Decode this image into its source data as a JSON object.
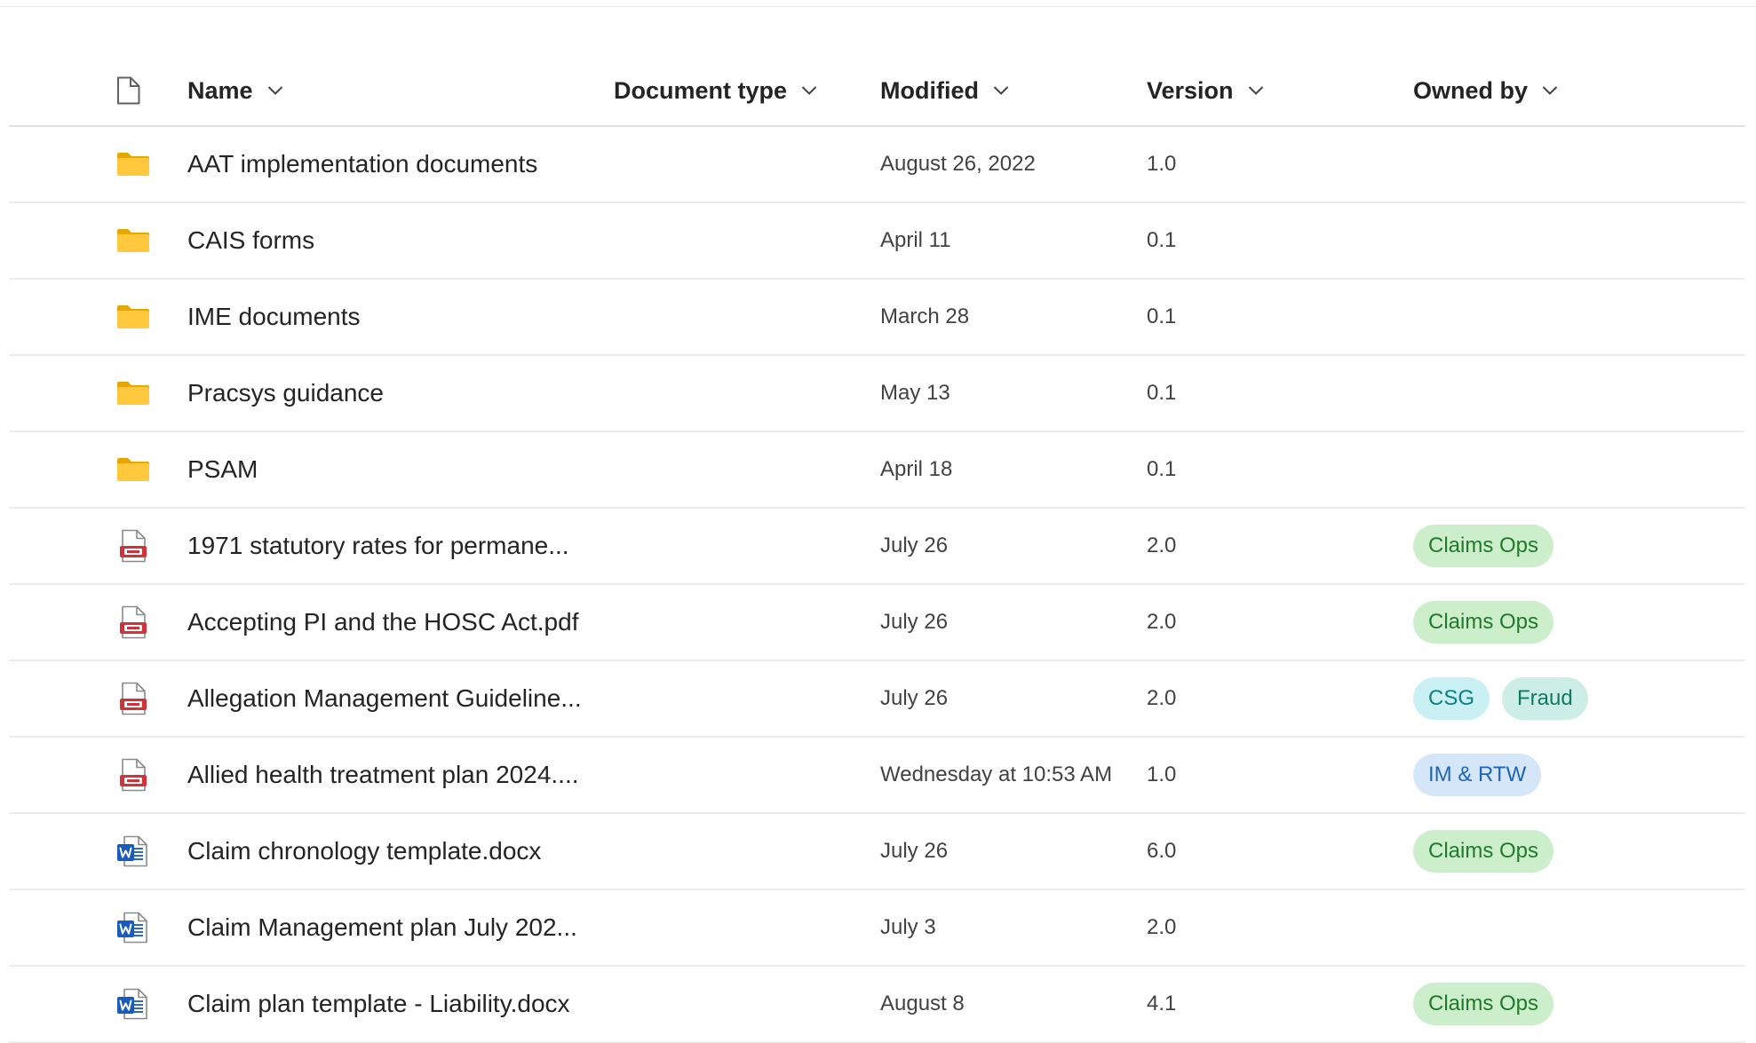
{
  "columns": {
    "type_icon": "document-icon",
    "name": "Name",
    "doc_type": "Document type",
    "modified": "Modified",
    "version": "Version",
    "owned_by": "Owned by"
  },
  "tag_colors": {
    "Claims Ops": {
      "bg": "#cdeecb",
      "fg": "#1f7a2b"
    },
    "CSG": {
      "bg": "#c9f1f3",
      "fg": "#0d7f86"
    },
    "Fraud": {
      "bg": "#cdeee6",
      "fg": "#0e7a66"
    },
    "IM & RTW": {
      "bg": "#d5e6f8",
      "fg": "#1e66b5"
    }
  },
  "rows": [
    {
      "icon": "folder-icon",
      "name": "AAT implementation documents",
      "doc_type": "",
      "modified": "August 26, 2022",
      "version": "1.0",
      "owners": []
    },
    {
      "icon": "folder-icon",
      "name": "CAIS forms",
      "doc_type": "",
      "modified": "April 11",
      "version": "0.1",
      "owners": []
    },
    {
      "icon": "folder-icon",
      "name": "IME documents",
      "doc_type": "",
      "modified": "March 28",
      "version": "0.1",
      "owners": []
    },
    {
      "icon": "folder-icon",
      "name": "Pracsys guidance",
      "doc_type": "",
      "modified": "May 13",
      "version": "0.1",
      "owners": []
    },
    {
      "icon": "folder-icon",
      "name": "PSAM",
      "doc_type": "",
      "modified": "April 18",
      "version": "0.1",
      "owners": []
    },
    {
      "icon": "pdf-icon",
      "name": "1971 statutory rates for permane...",
      "doc_type": "",
      "modified": "July 26",
      "version": "2.0",
      "owners": [
        "Claims Ops"
      ]
    },
    {
      "icon": "pdf-icon",
      "name": "Accepting PI and the HOSC Act.pdf",
      "doc_type": "",
      "modified": "July 26",
      "version": "2.0",
      "owners": [
        "Claims Ops"
      ]
    },
    {
      "icon": "pdf-icon",
      "name": "Allegation Management Guideline...",
      "doc_type": "",
      "modified": "July 26",
      "version": "2.0",
      "owners": [
        "CSG",
        "Fraud"
      ]
    },
    {
      "icon": "pdf-icon",
      "name": "Allied health treatment plan 2024....",
      "doc_type": "",
      "modified": "Wednesday at 10:53 AM",
      "version": "1.0",
      "owners": [
        "IM & RTW"
      ]
    },
    {
      "icon": "word-icon",
      "name": "Claim chronology template.docx",
      "doc_type": "",
      "modified": "July 26",
      "version": "6.0",
      "owners": [
        "Claims Ops"
      ]
    },
    {
      "icon": "word-icon",
      "name": "Claim Management plan July 202...",
      "doc_type": "",
      "modified": "July 3",
      "version": "2.0",
      "owners": []
    },
    {
      "icon": "word-icon",
      "name": "Claim plan template - Liability.docx",
      "doc_type": "",
      "modified": "August 8",
      "version": "4.1",
      "owners": [
        "Claims Ops"
      ]
    }
  ]
}
